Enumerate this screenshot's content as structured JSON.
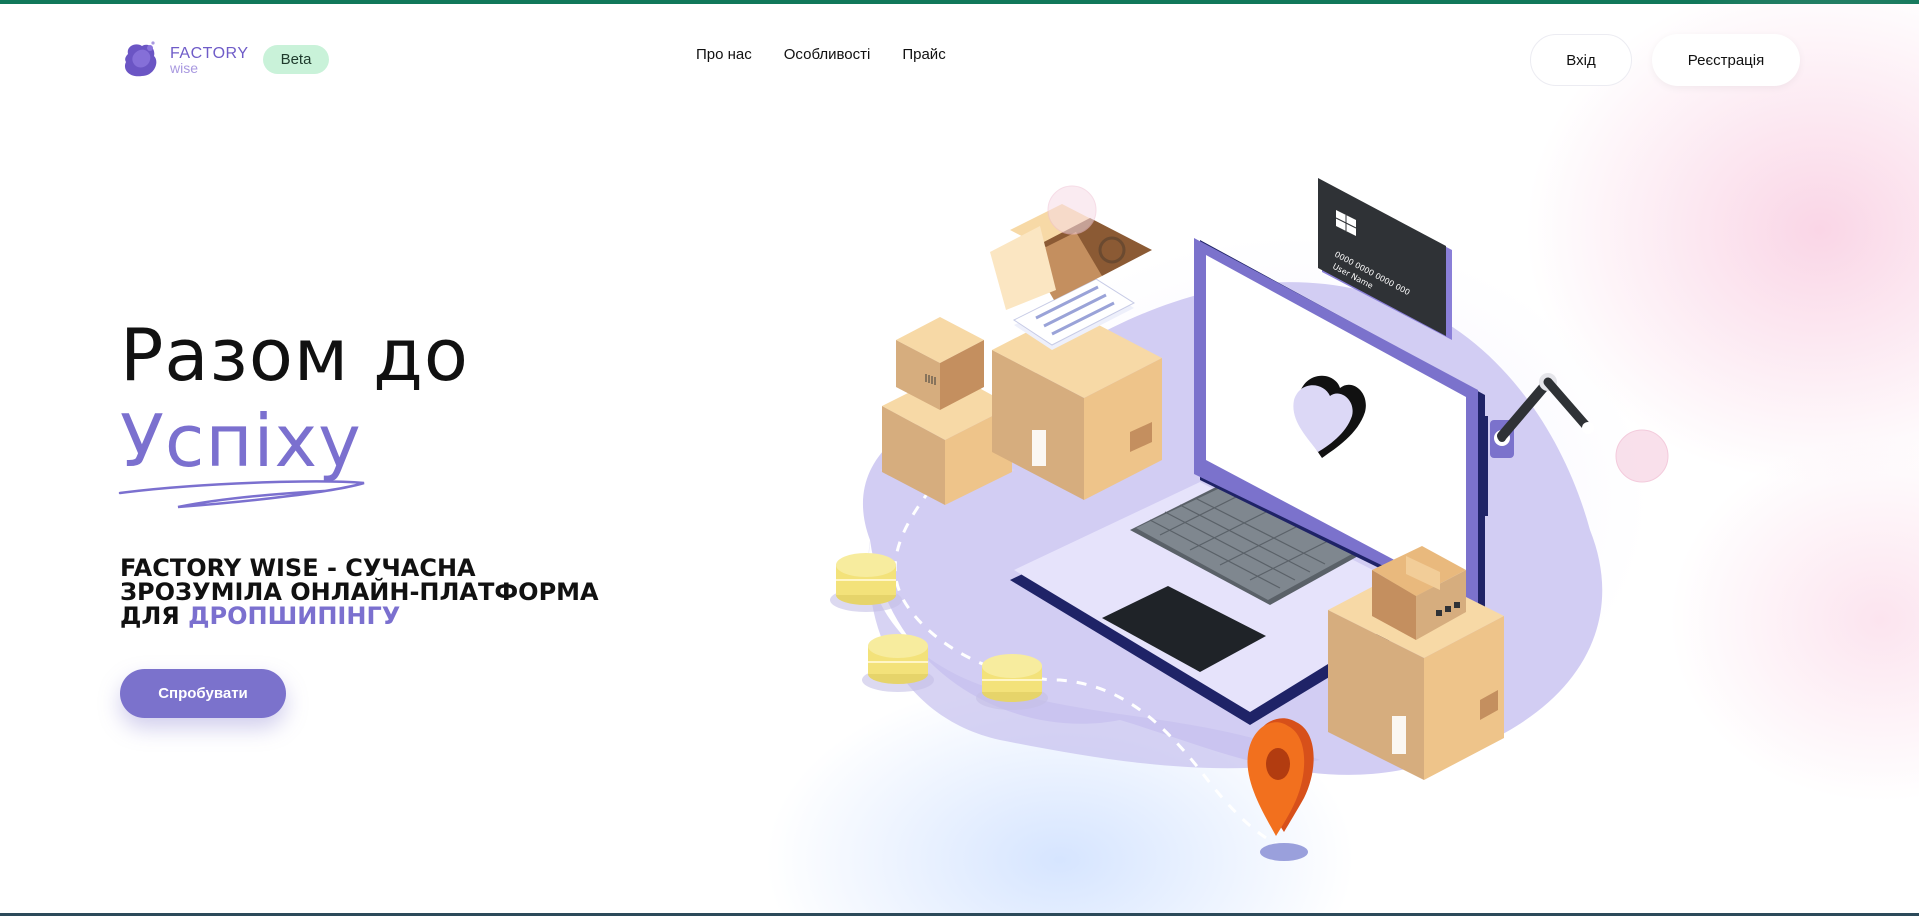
{
  "header": {
    "logo": {
      "line1": "FACTORY",
      "line2": "wise"
    },
    "beta_badge": "Beta",
    "nav": [
      {
        "label": "Про нас"
      },
      {
        "label": "Особливості"
      },
      {
        "label": "Прайс"
      }
    ],
    "login_label": "Вхід",
    "register_label": "Реєстрація"
  },
  "hero": {
    "title_line1": "Разом до",
    "title_line2": "Успіху",
    "subtitle_main": "FACTORY WISE - СУЧАСНА ЗРОЗУМІЛА ОНЛАЙН-ПЛАТФОРМА ДЛЯ ",
    "subtitle_accent": "ДРОПШИПІНГУ",
    "cta_label": "Спробувати"
  },
  "illustration": {
    "card_number": "0000 0000 0000 000",
    "card_name": "User Name"
  },
  "colors": {
    "accent": "#7b70cf",
    "top_strip": "#11785a",
    "beta_bg": "#c9f2d9",
    "pin": "#f2701e",
    "coin": "#f3e27a"
  }
}
